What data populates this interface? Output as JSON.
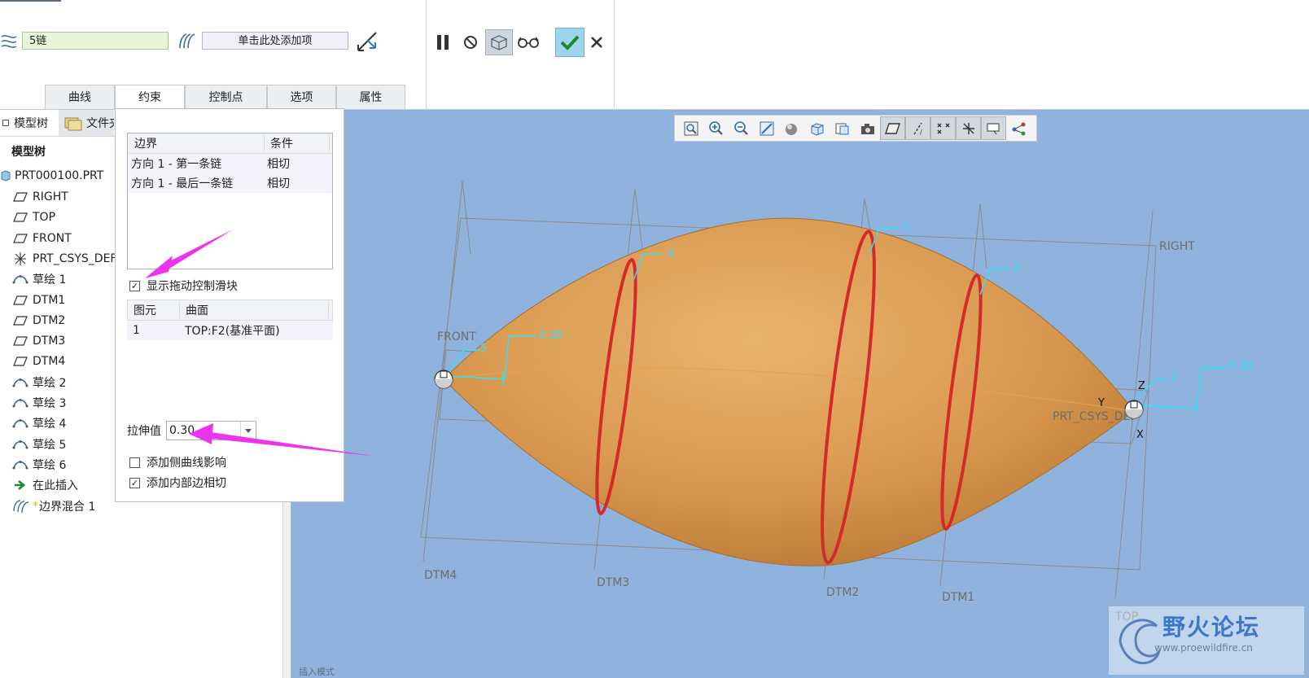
{
  "toolbar": {
    "chain_value": "5链",
    "add_item_placeholder": "单击此处添加项"
  },
  "tabs": [
    {
      "label": "曲线"
    },
    {
      "label": "约束"
    },
    {
      "label": "控制点"
    },
    {
      "label": "选项"
    },
    {
      "label": "属性"
    }
  ],
  "tree": {
    "tab_model": "模型树",
    "tab_files": "文件夹",
    "header": "模型树",
    "root": "PRT000100.PRT",
    "items": [
      {
        "label": "RIGHT",
        "icon": "datum-plane-icon"
      },
      {
        "label": "TOP",
        "icon": "datum-plane-icon"
      },
      {
        "label": "FRONT",
        "icon": "datum-plane-icon"
      },
      {
        "label": "PRT_CSYS_DEF",
        "icon": "coordinate-system-icon"
      },
      {
        "label": "草绘 1",
        "icon": "sketch-icon"
      },
      {
        "label": "DTM1",
        "icon": "datum-plane-icon"
      },
      {
        "label": "DTM2",
        "icon": "datum-plane-icon"
      },
      {
        "label": "DTM3",
        "icon": "datum-plane-icon"
      },
      {
        "label": "DTM4",
        "icon": "datum-plane-icon"
      },
      {
        "label": "草绘 2",
        "icon": "sketch-icon"
      },
      {
        "label": "草绘 3",
        "icon": "sketch-icon"
      },
      {
        "label": "草绘 4",
        "icon": "sketch-icon"
      },
      {
        "label": "草绘 5",
        "icon": "sketch-icon"
      },
      {
        "label": "草绘 6",
        "icon": "sketch-icon"
      },
      {
        "label": "在此插入",
        "icon": "insert-here-arrow-icon"
      },
      {
        "label": "边界混合 1",
        "icon": "boundary-blend-icon"
      }
    ]
  },
  "constraints_panel": {
    "boundary_table": {
      "headers": [
        "边界",
        "条件"
      ],
      "rows": [
        [
          "方向 1 - 第一条链",
          "相切"
        ],
        [
          "方向 1 - 最后一条链",
          "相切"
        ]
      ]
    },
    "show_drag_handles": {
      "label": "显示拖动控制滑块",
      "checked": true
    },
    "entity_table": {
      "headers": [
        "图元",
        "曲面"
      ],
      "rows": [
        [
          "1",
          "TOP:F2(基准平面)"
        ]
      ]
    },
    "stretch_label": "拉伸值",
    "stretch_value": "0.30",
    "add_side_curve": {
      "label": "添加侧曲线影响",
      "checked": false
    },
    "add_inner_edge": {
      "label": "添加内部边相切",
      "checked": true
    }
  },
  "viewport": {
    "labels": {
      "right": "RIGHT",
      "front": "FRONT",
      "top": "TOP",
      "csys": "PRT_CSYS_DEF",
      "dtm1": "DTM1",
      "dtm2": "DTM2",
      "dtm3": "DTM3",
      "dtm4": "DTM4",
      "axis_x": "X",
      "axis_y": "Y",
      "axis_z": "Z",
      "insert_mode": "插入模式"
    },
    "callouts": {
      "c1": "1",
      "c2": "2",
      "c3": "3",
      "c4": "4",
      "c5": "5",
      "left_value": "0.30",
      "right_value": "0.30"
    },
    "colors": {
      "background": "#8fb3dc",
      "surface": "#d9984f",
      "chain": "#d42a2a",
      "annotation": "#2fe1ff",
      "arrow": "#ee33ee"
    }
  },
  "watermark": {
    "title": "野火论坛",
    "url": "www.proewildfire.cn"
  }
}
